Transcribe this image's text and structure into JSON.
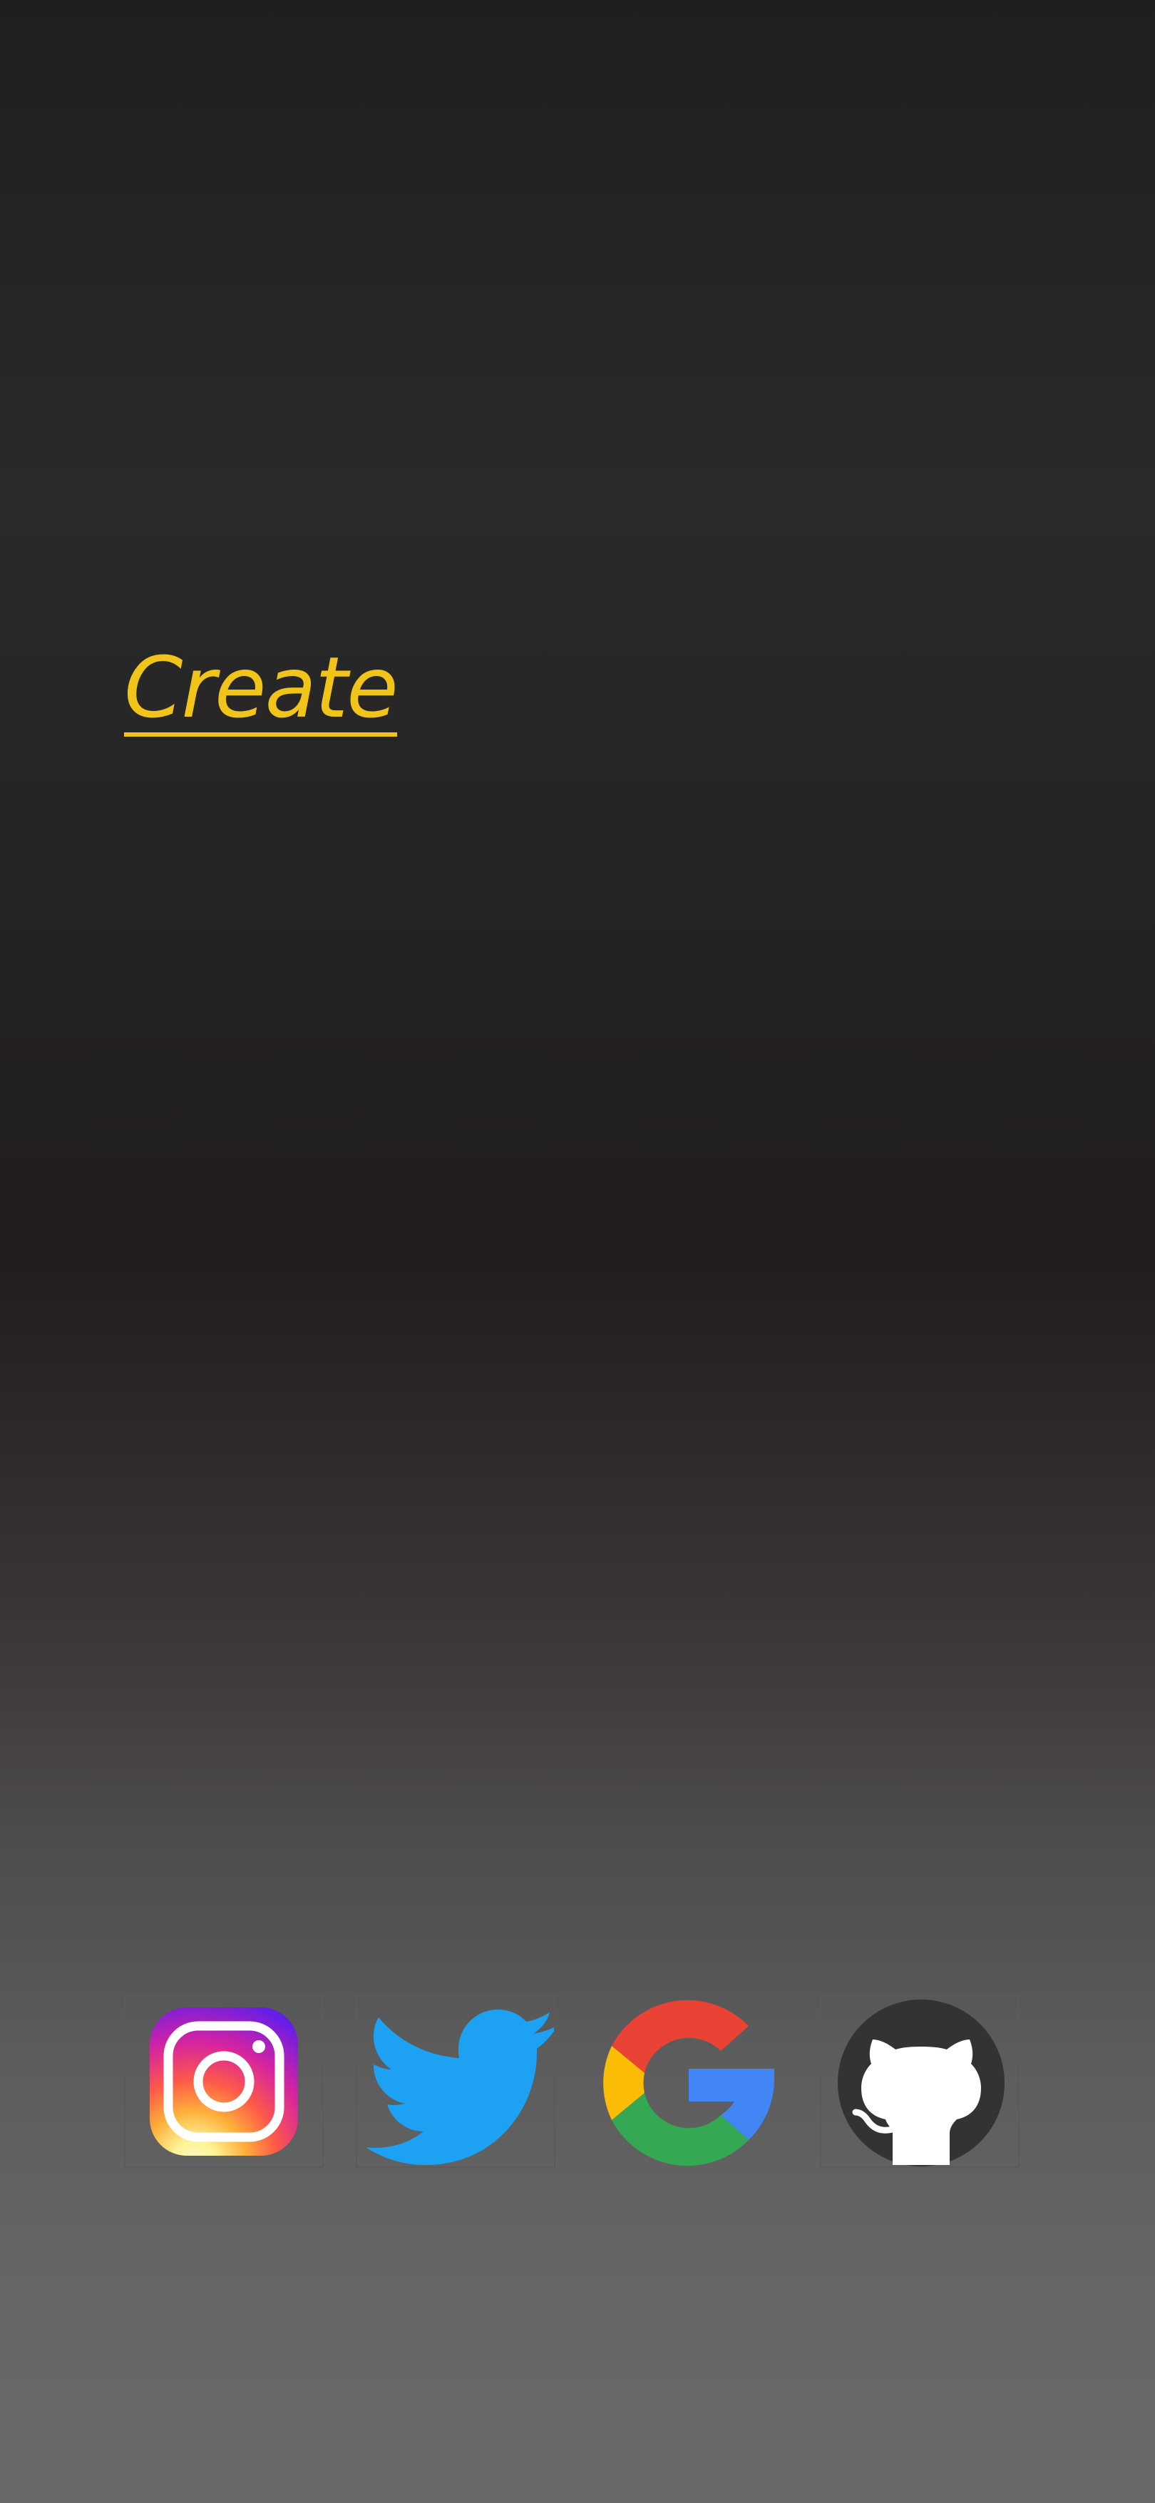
{
  "main": {
    "create_link": "Create"
  },
  "social": [
    {
      "name": "instagram",
      "icon": "instagram-icon",
      "colors": [
        "#4f5bd5",
        "#962fbf",
        "#d62976",
        "#fa7e1e",
        "#feda75"
      ]
    },
    {
      "name": "twitter",
      "icon": "twitter-icon",
      "colors": [
        "#1da1f2"
      ]
    },
    {
      "name": "google",
      "icon": "google-icon",
      "colors": [
        "#ea4335",
        "#fbbc05",
        "#34a853",
        "#4285f4"
      ]
    },
    {
      "name": "github",
      "icon": "github-icon",
      "colors": [
        "#333333",
        "#ffffff"
      ]
    }
  ],
  "theme": {
    "accent": "#f0c419"
  }
}
